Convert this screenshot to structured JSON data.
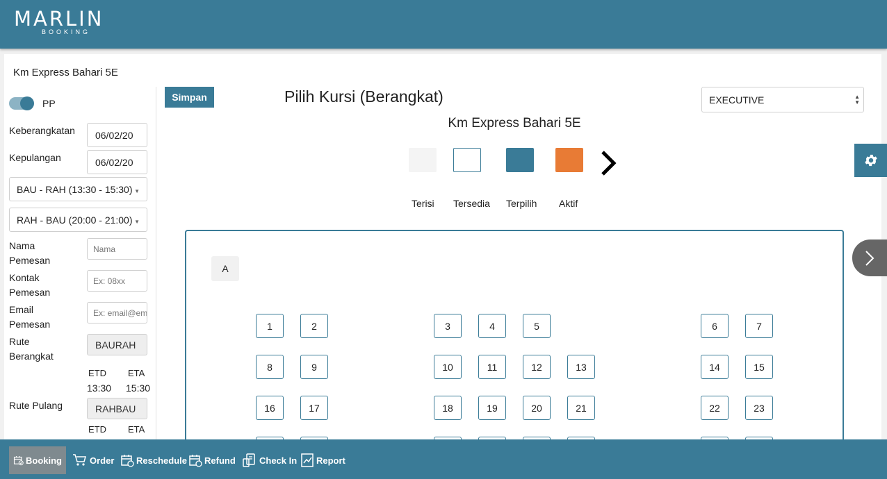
{
  "brand": {
    "name": "MARLIN",
    "sub": "BOOKING"
  },
  "ship_name": "Km Express Bahari 5E",
  "sidebar": {
    "pp_label": "PP",
    "pp_on": true,
    "departure_label": "Keberangkatan",
    "departure_value": "06/02/20",
    "return_label": "Kepulangan",
    "return_value": "06/02/20",
    "route_out": "BAU - RAH (13:30 - 15:30)",
    "route_back": "RAH - BAU (20:00 - 21:00)",
    "name_label": [
      "Nama",
      "Pemesan"
    ],
    "name_placeholder": "Nama",
    "contact_label": [
      "Kontak",
      "Pemesan"
    ],
    "contact_placeholder": "Ex: 08xx",
    "email_label": [
      "Email",
      "Pemesan"
    ],
    "email_placeholder": "Ex: email@em",
    "route_depart_label": [
      "Rute",
      "Berangkat"
    ],
    "route_depart_value": "BAURAH",
    "etd_label": "ETD",
    "eta_label": "ETA",
    "depart_etd": "13:30",
    "depart_eta": "15:30",
    "route_return_label": "Rute Pulang",
    "route_return_value": "RAHBAU"
  },
  "main": {
    "save_label": "Simpan",
    "heading": "Pilih Kursi (Berangkat)",
    "subheading": "Km Express Bahari 5E",
    "class_select": "EXECUTIVE"
  },
  "legend": [
    {
      "label": "Terisi",
      "color": "#f4f4f4",
      "border": "none"
    },
    {
      "label": "Tersedia",
      "color": "#ffffff",
      "border": "#3a7b97"
    },
    {
      "label": "Terpilih",
      "color": "#3a7b97",
      "border": "none"
    },
    {
      "label": "Aktif",
      "color": "#e87b35",
      "border": "none"
    }
  ],
  "seatmap": {
    "row_label": "A",
    "rows": [
      [
        "1",
        "2",
        "",
        "3",
        "4",
        "5",
        "",
        "6",
        "7"
      ],
      [
        "8",
        "9",
        "",
        "10",
        "11",
        "12",
        "13",
        "14",
        "15"
      ],
      [
        "16",
        "17",
        "",
        "18",
        "19",
        "20",
        "21",
        "22",
        "23"
      ],
      [
        "",
        "",
        "",
        "",
        "",
        "",
        "",
        "",
        ""
      ]
    ]
  },
  "bottom_nav": [
    {
      "label": "Booking",
      "icon": "calendar-check-icon",
      "active": true
    },
    {
      "label": "Order",
      "icon": "cart-icon",
      "active": false
    },
    {
      "label": "Reschedule",
      "icon": "calendar-edit-icon",
      "active": false
    },
    {
      "label": "Refund",
      "icon": "calendar-refund-icon",
      "active": false
    },
    {
      "label": "Check In",
      "icon": "checkin-icon",
      "active": false
    },
    {
      "label": "Report",
      "icon": "report-icon",
      "active": false
    }
  ],
  "colors": {
    "primary": "#3a7b97",
    "active_seat": "#e87b35"
  }
}
